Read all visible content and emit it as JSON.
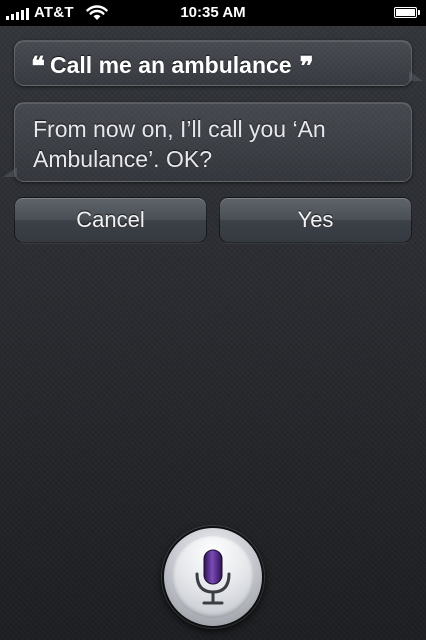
{
  "status_bar": {
    "carrier": "AT&T",
    "time": "10:35 AM",
    "signal_bars": 5,
    "battery_level": 1.0,
    "icons": [
      "signal-icon",
      "wifi-icon",
      "battery-icon"
    ]
  },
  "conversation": {
    "user_utterance": "Call me an ambulance",
    "assistant_reply": "From now on, I’ll call you ‘An Ambulance’. OK?",
    "open_quote": "❝",
    "close_quote": "❞"
  },
  "buttons": {
    "cancel_label": "Cancel",
    "yes_label": "Yes"
  },
  "mic": {
    "icon": "microphone-icon",
    "accent_color": "#5b2d8e"
  },
  "colors": {
    "background": "#2a2c30",
    "text": "#ffffff",
    "status_bar": "#000000"
  }
}
